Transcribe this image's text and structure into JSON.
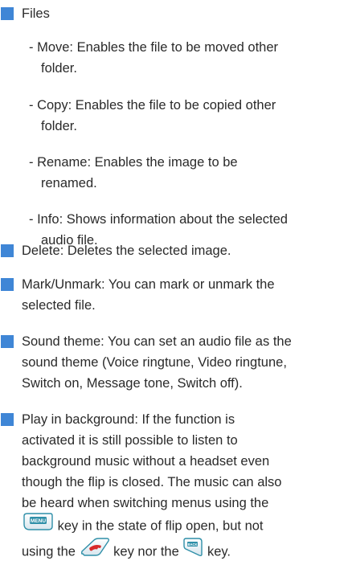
{
  "colors": {
    "bullet": "#3f86d6",
    "text": "#2a2a2a"
  },
  "files": {
    "heading": "Files",
    "sub_items": [
      {
        "line1": "- Move: Enables the file to be moved other",
        "line2": "folder."
      },
      {
        "line1": "- Copy: Enables the file to be copied other",
        "line2": "folder."
      },
      {
        "line1": "- Rename: Enables the image to be",
        "line2": "renamed."
      },
      {
        "line1": "- Info: Shows information about the selected",
        "line2": "audio file."
      }
    ]
  },
  "delete": {
    "line1": "Delete: Deletes the selected image."
  },
  "mark": {
    "line1": "Mark/Unmark: You can mark or unmark the",
    "line2": "selected file."
  },
  "sound_theme": {
    "line1": "Sound theme: You can set an audio file as the",
    "line2": "sound theme (Voice ringtune, Video ringtune,",
    "line3": "Switch on, Message tone, Switch off)."
  },
  "play_background": {
    "line1": "Play in background: If the function is",
    "line2": "activated it is still possible to listen to",
    "line3": "background music without a headset even",
    "line4": "though the flip is closed. The music can also",
    "line5": "be heard when switching menus using the",
    "line6_after_key": " key in the state of flip open, but not",
    "line7_before": "using the ",
    "line7_middle": " key nor the ",
    "line7_after": " key.",
    "key_icons": [
      "menu-key-icon",
      "end-call-key-icon",
      "back-key-icon"
    ],
    "menu_key_label": "MENU",
    "back_key_label": "BACK"
  }
}
